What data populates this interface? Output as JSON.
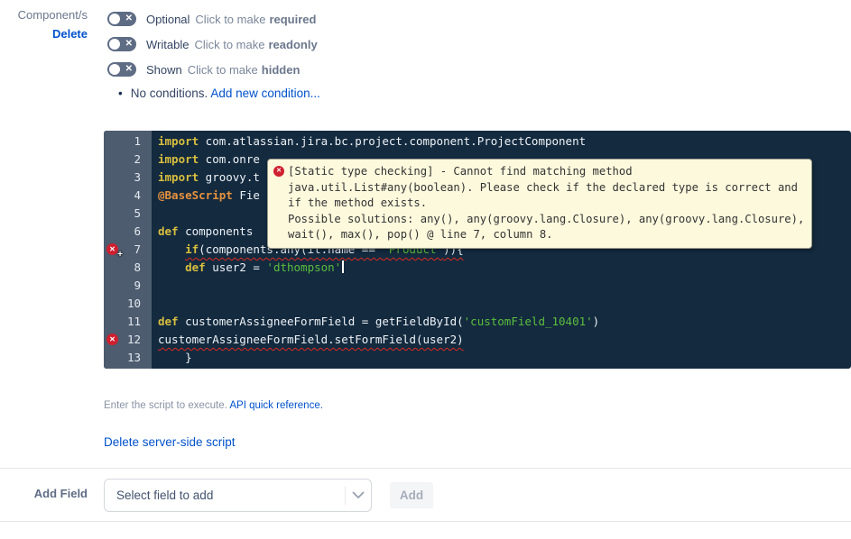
{
  "field_panel": {
    "field_label": "Component/s",
    "delete_label": "Delete",
    "toggles": [
      {
        "label": "Optional",
        "hint": "Click to make",
        "target": "required"
      },
      {
        "label": "Writable",
        "hint": "Click to make",
        "target": "readonly"
      },
      {
        "label": "Shown",
        "hint": "Click to make",
        "target": "hidden"
      }
    ],
    "conditions": {
      "bullet": "•",
      "text": "No conditions.",
      "link": "Add new condition..."
    }
  },
  "editor": {
    "lines": [
      {
        "n": 1,
        "tokens": [
          [
            "kw",
            "import"
          ],
          [
            "plain",
            " com.atlassian.jira.bc.project.component.ProjectComponent"
          ]
        ]
      },
      {
        "n": 2,
        "tokens": [
          [
            "kw",
            "import"
          ],
          [
            "plain",
            " com.onre"
          ]
        ]
      },
      {
        "n": 3,
        "tokens": [
          [
            "kw",
            "import"
          ],
          [
            "plain",
            " groovy.t"
          ]
        ]
      },
      {
        "n": 4,
        "tokens": [
          [
            "ann",
            "@BaseScript"
          ],
          [
            "plain",
            " Fie"
          ]
        ]
      },
      {
        "n": 5,
        "tokens": []
      },
      {
        "n": 6,
        "tokens": [
          [
            "kw",
            "def"
          ],
          [
            "plain",
            " components "
          ]
        ]
      },
      {
        "n": 7,
        "indent": "    ",
        "sq": true,
        "err": true,
        "cursorIcon": true,
        "tokens": [
          [
            "kw",
            "if"
          ],
          [
            "plain",
            "(components.any(it.name == "
          ],
          [
            "str",
            "'Product'"
          ],
          [
            "plain",
            ")){"
          ]
        ]
      },
      {
        "n": 8,
        "indent": "    ",
        "caret": true,
        "tokens": [
          [
            "kw",
            "def"
          ],
          [
            "plain",
            " user2 = "
          ],
          [
            "str",
            "'dthompson'"
          ]
        ]
      },
      {
        "n": 9,
        "tokens": []
      },
      {
        "n": 10,
        "tokens": []
      },
      {
        "n": 11,
        "tokens": [
          [
            "kw",
            "def"
          ],
          [
            "plain",
            " customerAssigneeFormField = getFieldById("
          ],
          [
            "str",
            "'customField_10401'"
          ],
          [
            "plain",
            ")"
          ]
        ]
      },
      {
        "n": 12,
        "sq": true,
        "err": true,
        "tokens": [
          [
            "plain",
            "customerAssigneeFormField.setFormField(user2)"
          ]
        ]
      },
      {
        "n": 13,
        "indent": "    ",
        "tokens": [
          [
            "plain",
            "}"
          ]
        ]
      }
    ],
    "tooltip": {
      "icon": "✕",
      "lines": [
        "[Static type checking] - Cannot find matching method",
        "java.util.List#any(boolean). Please check if the declared type is correct and",
        "if the method exists.",
        "Possible solutions: any(), any(groovy.lang.Closure), any(groovy.lang.Closure),",
        "wait(), max(), pop() @ line 7, column 8."
      ]
    },
    "colors": {
      "background": "#132a3f",
      "gutter": "#4d5c6f",
      "line_number": "#e3e9f0",
      "keyword": "#d9bf3f",
      "annotation": "#e8923d",
      "string": "#5dbe3d",
      "plain": "#eef2f6",
      "error_marker": "#cf2030",
      "squiggle": "#e02a1e",
      "tooltip_bg": "#fdf9dd",
      "tooltip_text": "#333333"
    }
  },
  "script_section": {
    "hint": "Enter the script to execute.",
    "hint_link": "API quick reference.",
    "delete_link": "Delete server-side script"
  },
  "add_field": {
    "label": "Add Field",
    "placeholder": "Select field to add",
    "button": "Add"
  },
  "colors": {
    "link": "#0052cc",
    "label_gray": "#6b778c",
    "toggle": "#5e6c84"
  }
}
